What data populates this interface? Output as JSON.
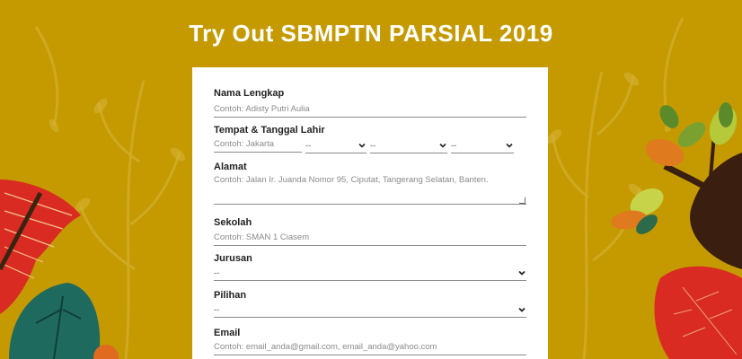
{
  "title": "Try Out SBMPTN PARSIAL 2019",
  "colors": {
    "background": "#c49a00",
    "card": "#ffffff",
    "red": "#d92b22",
    "teal": "#1f6a5e",
    "green": "#7aa12f"
  },
  "form": {
    "nama": {
      "label": "Nama Lengkap",
      "placeholder": "Contoh: Adisty Putri Aulia"
    },
    "ttl": {
      "label": "Tempat & Tanggal Lahir",
      "place_placeholder": "Contoh: Jakarta",
      "day": "--",
      "month": "--",
      "year": "--"
    },
    "alamat": {
      "label": "Alamat",
      "placeholder": "Contoh: Jalan Ir. Juanda Nomor 95, Ciputat, Tangerang Selatan, Banten."
    },
    "sekolah": {
      "label": "Sekolah",
      "placeholder": "Contoh: SMAN 1 Ciasem"
    },
    "jurusan": {
      "label": "Jurusan",
      "value": "--"
    },
    "pilihan": {
      "label": "Pilihan",
      "value": "--"
    },
    "email": {
      "label": "Email",
      "placeholder": "Contoh: email_anda@gmail.com, email_anda@yahoo.com"
    }
  }
}
